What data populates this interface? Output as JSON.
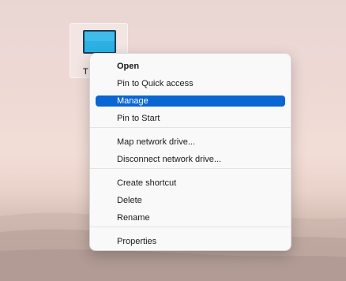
{
  "desktop": {
    "icon_name": "this-pc-icon",
    "icon_label_fragment": "T"
  },
  "context_menu": {
    "groups": [
      [
        {
          "label": "Open",
          "bold": true
        },
        {
          "label": "Pin to Quick access"
        },
        {
          "label": "Manage",
          "highlighted": true
        },
        {
          "label": "Pin to Start"
        }
      ],
      [
        {
          "label": "Map network drive..."
        },
        {
          "label": "Disconnect network drive..."
        }
      ],
      [
        {
          "label": "Create shortcut"
        },
        {
          "label": "Delete"
        },
        {
          "label": "Rename"
        }
      ],
      [
        {
          "label": "Properties"
        }
      ]
    ]
  },
  "colors": {
    "highlight": "#0a66d2",
    "menu_background": "#f9f9f9"
  }
}
